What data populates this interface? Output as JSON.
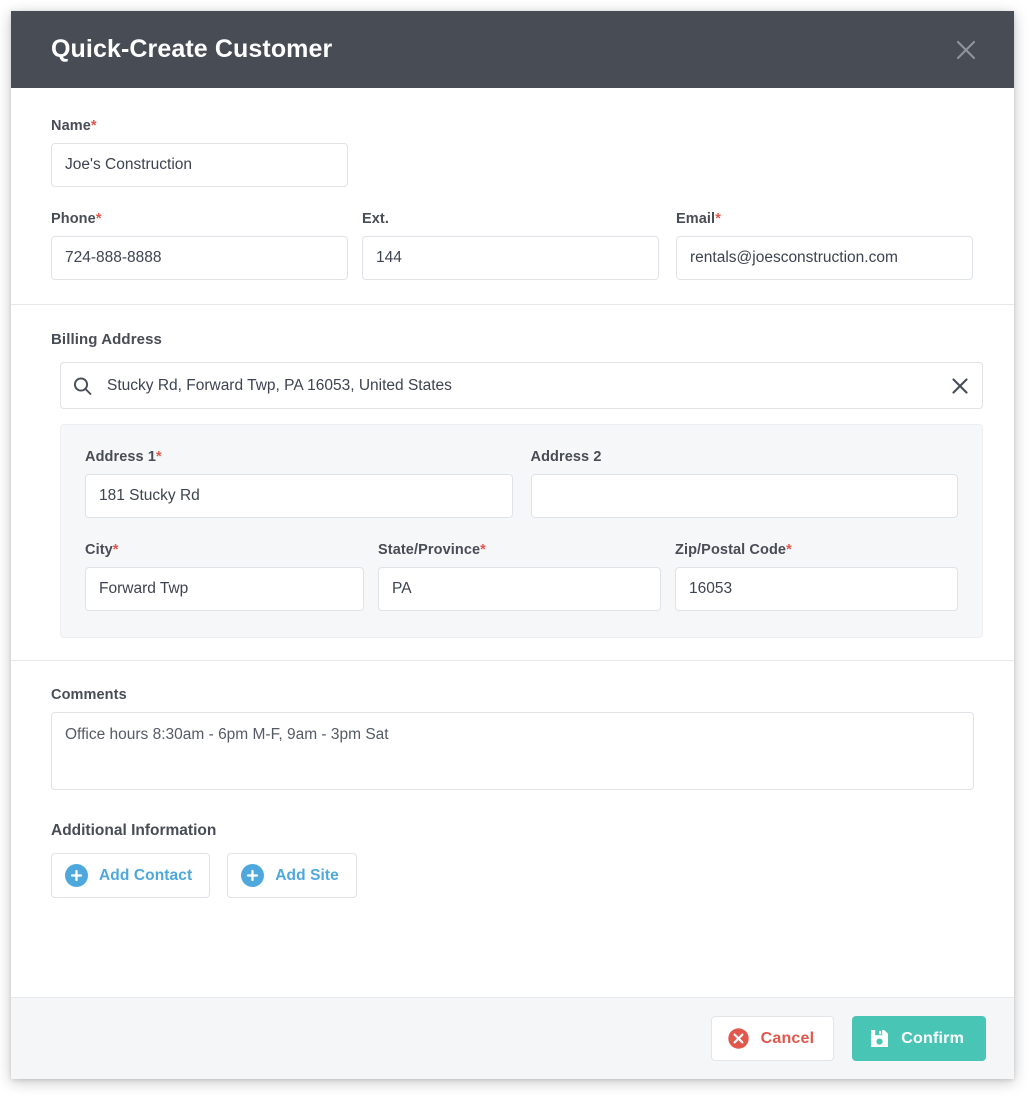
{
  "dialog": {
    "title": "Quick-Create Customer",
    "close_icon": "close-icon"
  },
  "colors": {
    "header_bg": "#474c55",
    "accent_blue": "#4ea8dd",
    "confirm_teal": "#49c5b6",
    "danger_red": "#e2574c",
    "panel_bg": "#f6f7f9",
    "footer_bg": "#f5f6f8",
    "border": "#dfe3e8"
  },
  "form": {
    "name": {
      "label": "Name",
      "required": "*",
      "value": "Joe's Construction",
      "placeholder": ""
    },
    "phone": {
      "label": "Phone",
      "required": "*",
      "value": "724-888-8888",
      "placeholder": ""
    },
    "ext": {
      "label": "Ext.",
      "required": "",
      "value": "144",
      "placeholder": ""
    },
    "email": {
      "label": "Email",
      "required": "*",
      "value": "rentals@joesconstruction.com",
      "placeholder": ""
    }
  },
  "billing": {
    "heading": "Billing Address",
    "search": {
      "value": "Stucky Rd, Forward Twp, PA 16053, United States",
      "placeholder": "Search address",
      "search_icon": "search-icon",
      "clear_icon": "clear-icon"
    },
    "address1": {
      "label": "Address 1",
      "required": "*",
      "value": "181 Stucky Rd",
      "placeholder": ""
    },
    "address2": {
      "label": "Address 2",
      "required": "",
      "value": "",
      "placeholder": ""
    },
    "city": {
      "label": "City",
      "required": "*",
      "value": "Forward Twp",
      "placeholder": ""
    },
    "state": {
      "label": "State/Province",
      "required": "*",
      "value": "PA",
      "placeholder": ""
    },
    "zip": {
      "label": "Zip/Postal Code",
      "required": "*",
      "value": "16053",
      "placeholder": ""
    }
  },
  "comments": {
    "label": "Comments",
    "value": "Office hours 8:30am - 6pm M-F, 9am - 3pm Sat",
    "placeholder": ""
  },
  "additional": {
    "heading": "Additional Information",
    "buttons": [
      {
        "label": "Add Contact",
        "icon": "plus-circle-icon"
      },
      {
        "label": "Add Site",
        "icon": "plus-circle-icon"
      }
    ]
  },
  "footer": {
    "cancel": {
      "label": "Cancel",
      "icon": "circle-x-icon"
    },
    "confirm": {
      "label": "Confirm",
      "icon": "save-disk-icon"
    }
  }
}
